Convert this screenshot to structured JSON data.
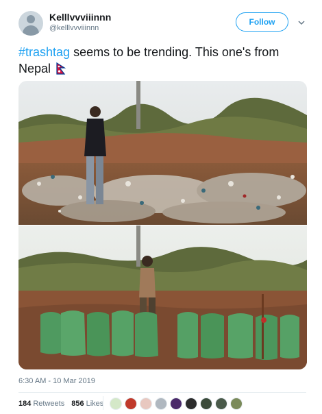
{
  "user": {
    "name": "Kelllvvviiinnn",
    "handle": "@kelllvvviiinnn",
    "follow_label": "Follow"
  },
  "tweet": {
    "hashtag": "#trashtag",
    "text_rest": " seems to be trending. This one's from Nepal"
  },
  "meta": {
    "timestamp": "6:30 AM - 10 Mar 2019",
    "retweets_count": "184",
    "retweets_label": "Retweets",
    "likes_count": "856",
    "likes_label": "Likes"
  },
  "likers": [
    "#d4e8c8",
    "#c0392b",
    "#e8c8c0",
    "#b0b8c0",
    "#4a2a6a",
    "#2c2c2c",
    "#3a4a3a",
    "#4a5a4a",
    "#7a8a5a"
  ],
  "colors": {
    "accent": "#1da1f2"
  }
}
